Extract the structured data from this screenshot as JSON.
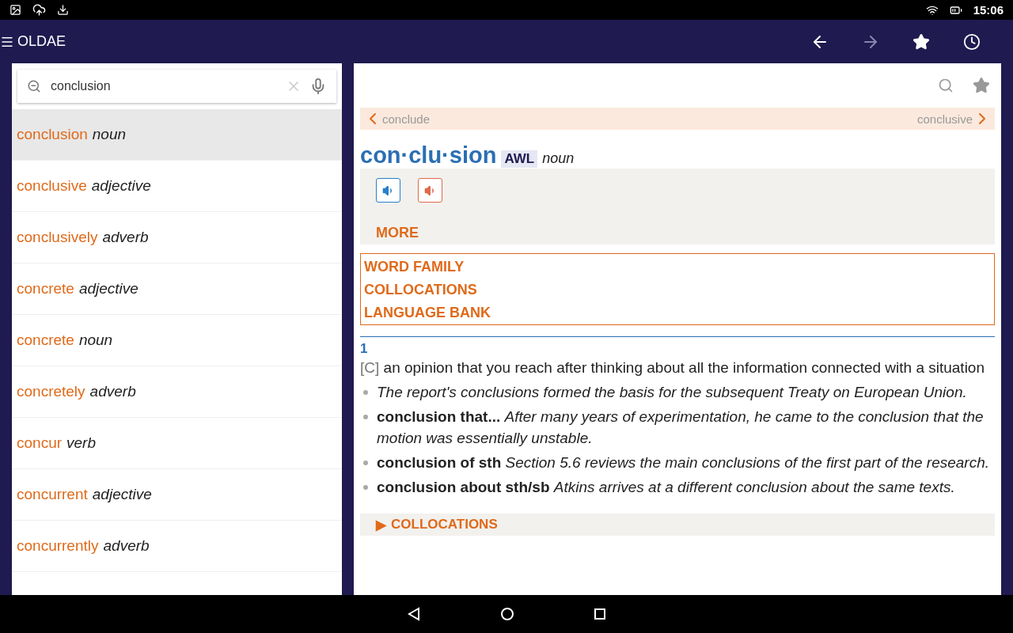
{
  "status_bar": {
    "time": "15:06"
  },
  "app_bar": {
    "title": "OLDAE"
  },
  "search": {
    "value": "conclusion"
  },
  "results": [
    {
      "word": "conclusion",
      "pos": "noun",
      "selected": true
    },
    {
      "word": "conclusive",
      "pos": "adjective",
      "selected": false
    },
    {
      "word": "conclusively",
      "pos": "adverb",
      "selected": false
    },
    {
      "word": "concrete",
      "pos": "adjective",
      "selected": false
    },
    {
      "word": "concrete",
      "pos": "noun",
      "selected": false
    },
    {
      "word": "concretely",
      "pos": "adverb",
      "selected": false
    },
    {
      "word": "concur",
      "pos": "verb",
      "selected": false
    },
    {
      "word": "concurrent",
      "pos": "adjective",
      "selected": false
    },
    {
      "word": "concurrently",
      "pos": "adverb",
      "selected": false
    }
  ],
  "entry": {
    "prev": "conclude",
    "next": "conclusive",
    "headword": "con·clu·sion",
    "label": "AWL",
    "pos": "noun",
    "more": "MORE",
    "links": [
      "WORD FAMILY",
      "COLLOCATIONS",
      "LANGUAGE BANK"
    ],
    "sense_number": "1",
    "grammar": "[C]",
    "definition": "an opinion that you reach after thinking about all the information connected with a situation",
    "examples": [
      {
        "text": "The report's conclusions formed the basis for the subsequent Treaty on European Union."
      },
      {
        "phrase": "conclusion that...",
        "text": "After many years of experimentation, he came to the conclusion that the motion was essentially unstable."
      },
      {
        "phrase": "conclusion of sth",
        "text": "Section 5.6 reviews the main conclusions of the first part of the research."
      },
      {
        "phrase": "conclusion about sth/sb",
        "text": "Atkins arrives at a different conclusion about the same texts."
      }
    ],
    "section": {
      "marker": "▶",
      "title": "COLLOCATIONS",
      "expanded": false
    }
  }
}
